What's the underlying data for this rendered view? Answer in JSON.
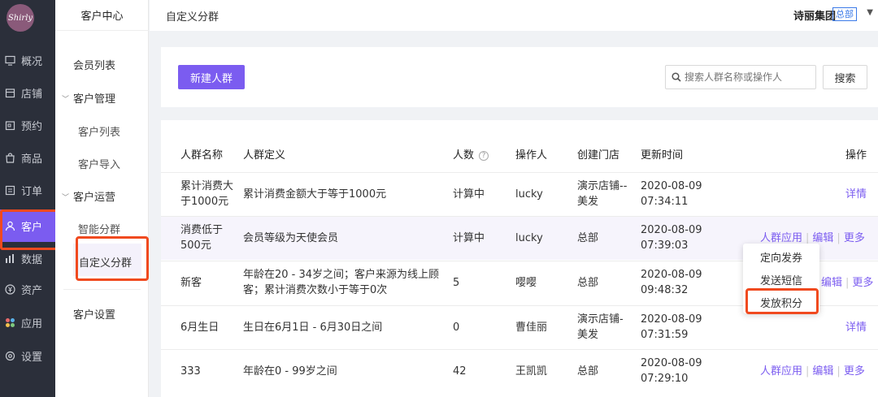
{
  "brand": {
    "logo_text": "Shirly",
    "primary_color": "#7b5cf0",
    "highlight_color": "#f04a1f"
  },
  "nav": {
    "items": [
      {
        "label": "概况",
        "icon": "monitor-icon"
      },
      {
        "label": "店铺",
        "icon": "store-icon"
      },
      {
        "label": "预约",
        "icon": "calendar-icon"
      },
      {
        "label": "商品",
        "icon": "bag-icon"
      },
      {
        "label": "订单",
        "icon": "list-icon"
      },
      {
        "label": "客户",
        "icon": "user-icon",
        "active": true
      },
      {
        "label": "数据",
        "icon": "bar-chart-icon"
      },
      {
        "label": "资产",
        "icon": "yen-icon"
      },
      {
        "label": "应用",
        "icon": "apps-icon"
      },
      {
        "label": "设置",
        "icon": "gear-icon"
      }
    ]
  },
  "submenu": {
    "title": "客户中心",
    "member_list": "会员列表",
    "customer_mgmt": "客户管理",
    "customer_list": "客户列表",
    "customer_import": "客户导入",
    "customer_ops": "客户运营",
    "smart_group": "智能分群",
    "custom_group": "自定义分群",
    "customer_settings": "客户设置"
  },
  "header": {
    "title": "自定义分群",
    "company": "诗丽集团",
    "badge": "总部",
    "caret": "▼"
  },
  "toolbar": {
    "new_button": "新建人群",
    "search_placeholder": "搜索人群名称或操作人",
    "search_button": "搜索"
  },
  "table": {
    "columns": {
      "name": "人群名称",
      "definition": "人群定义",
      "count": "人数",
      "operator": "操作人",
      "store": "创建门店",
      "updated": "更新时间",
      "actions": "操作"
    },
    "rows": [
      {
        "name_l1": "累计消费大",
        "name_l2": "于1000元",
        "definition_l1": "累计消费金额大于等于1000元",
        "definition_l2": "",
        "count": "计算中",
        "operator": "lucky",
        "store_l1": "演示店铺--",
        "store_l2": "美发",
        "date": "2020-08-09",
        "time": "07:34:11",
        "action_detail": "详情"
      },
      {
        "name_l1": "消费低于",
        "name_l2": "500元",
        "definition_l1": "会员等级为天使会员",
        "definition_l2": "",
        "count": "计算中",
        "operator": "lucky",
        "store_l1": "总部",
        "store_l2": "",
        "date": "2020-08-09",
        "time": "07:39:03",
        "action_apply": "人群应用",
        "action_edit": "编辑",
        "action_more": "更多"
      },
      {
        "name_l1": "新客",
        "name_l2": "",
        "definition_l1": "年龄在20 - 34岁之间；客户来源为线上顾",
        "definition_l2": "客；累计消费次数小于等于0次",
        "count": "5",
        "operator": "嘤嘤",
        "store_l1": "总部",
        "store_l2": "",
        "date": "2020-08-09",
        "time": "09:48:32",
        "action_edit": "编辑",
        "action_more": "更多"
      },
      {
        "name_l1": "6月生日",
        "name_l2": "",
        "definition_l1": "生日在6月1日 - 6月30日之间",
        "definition_l2": "",
        "count": "0",
        "operator": "曹佳丽",
        "store_l1": "演示店铺-",
        "store_l2": "美发",
        "date": "2020-08-09",
        "time": "07:31:59",
        "action_detail": "详情"
      },
      {
        "name_l1": "333",
        "name_l2": "",
        "definition_l1": "年龄在0 - 99岁之间",
        "definition_l2": "",
        "count": "42",
        "operator": "王凯凯",
        "store_l1": "总部",
        "store_l2": "",
        "date": "2020-08-09",
        "time": "07:29:10",
        "action_apply": "人群应用",
        "action_edit": "编辑",
        "action_more": "更多"
      }
    ]
  },
  "dropdown": {
    "items": [
      "定向发券",
      "发送短信",
      "发放积分"
    ]
  }
}
